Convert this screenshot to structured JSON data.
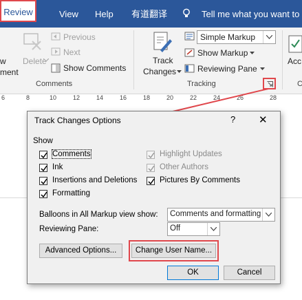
{
  "tabs": {
    "review": "Review",
    "view": "View",
    "help": "Help",
    "translate": "有道翻译",
    "tell_me": "Tell me what you want to do"
  },
  "ribbon": {
    "left_partial_1": "w",
    "left_partial_2": "ment",
    "delete": "Delete",
    "previous": "Previous",
    "next": "Next",
    "show_comments": "Show Comments",
    "comments_group": "Comments",
    "track_changes_1": "Track",
    "track_changes_2": "Changes",
    "markup_select": "Simple Markup",
    "show_markup": "Show Markup",
    "reviewing_pane": "Reviewing Pane",
    "tracking_group": "Tracking",
    "accept_partial": "Acc",
    "right_partial": "C"
  },
  "ruler": {
    "ticks": [
      "6",
      "8",
      "10",
      "12",
      "14",
      "16",
      "18",
      "20",
      "22",
      "24",
      "26",
      "28"
    ]
  },
  "dialog": {
    "title": "Track Changes Options",
    "help": "?",
    "close": "✕",
    "show_heading": "Show",
    "comments": "Comments",
    "ink": "Ink",
    "insertions_deletions": "Insertions and Deletions",
    "formatting": "Formatting",
    "highlight_updates": "Highlight Updates",
    "other_authors": "Other Authors",
    "pictures_by_comments": "Pictures By Comments",
    "balloons_label": "Balloons in All Markup view show:",
    "balloons_value": "Comments and formatting",
    "reviewing_pane_label": "Reviewing Pane:",
    "reviewing_pane_value": "Off",
    "advanced_options": "Advanced Options...",
    "change_user_name": "Change User Name...",
    "ok": "OK",
    "cancel": "Cancel"
  },
  "colors": {
    "ribbon_blue": "#2b579a",
    "highlight_red": "#e0474c"
  }
}
